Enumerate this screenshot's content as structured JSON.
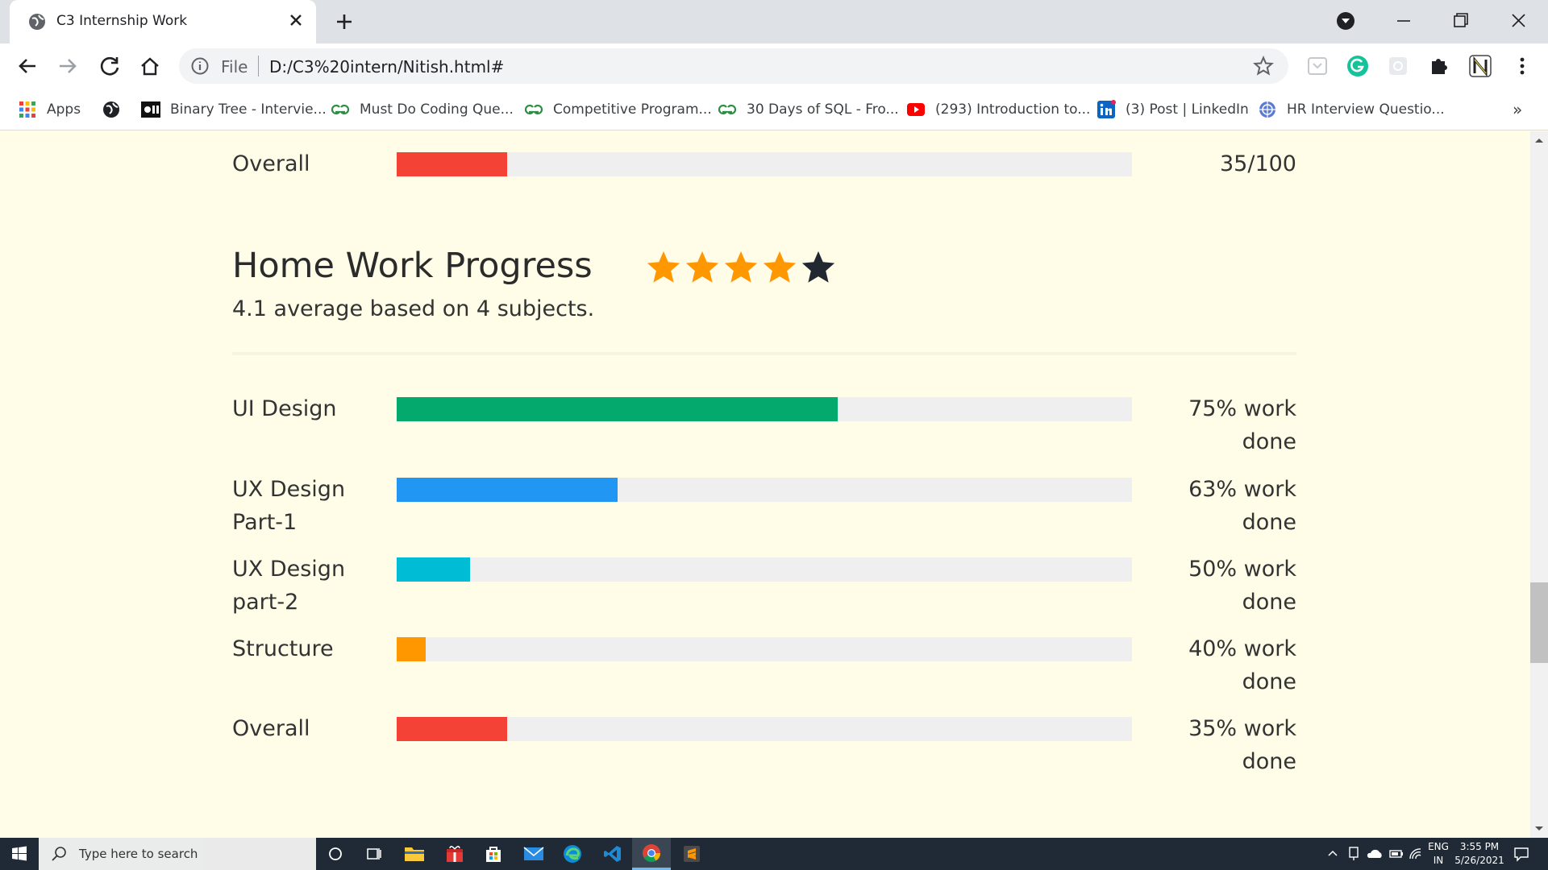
{
  "browser": {
    "tab_title": "C3 Internship Work",
    "address_scheme": "File",
    "address_url": "D:/C3%20intern/Nitish.html#",
    "bookmarks": [
      {
        "label": "Apps",
        "icon": "apps-grid-icon"
      },
      {
        "label": "",
        "icon": "globe-icon"
      },
      {
        "label": "Binary Tree - Intervie...",
        "icon": "interviewbit-icon"
      },
      {
        "label": "Must Do Coding Que...",
        "icon": "geeksforgeeks-icon"
      },
      {
        "label": "Competitive Program...",
        "icon": "geeksforgeeks-icon"
      },
      {
        "label": "30 Days of SQL - Fro...",
        "icon": "geeksforgeeks-icon"
      },
      {
        "label": "(293) Introduction to...",
        "icon": "youtube-icon"
      },
      {
        "label": "(3) Post | LinkedIn",
        "icon": "linkedin-icon"
      },
      {
        "label": "HR Interview Questio...",
        "icon": "site-icon"
      }
    ],
    "more_bookmarks": "»"
  },
  "page": {
    "top_overall": {
      "label": "Overall",
      "value": "35/100",
      "percent": 15,
      "color": "#f44336"
    },
    "homework": {
      "title": "Home Work Progress",
      "rating": 4,
      "rating_max": 5,
      "star_color": "#ff9800",
      "subtitle": "4.1 average based on 4 subjects.",
      "rows": [
        {
          "label": "UI Design",
          "value": "75% work done",
          "percent": 60,
          "color": "#04aa6d"
        },
        {
          "label": "UX Design Part-1",
          "value": "63% work done",
          "percent": 30,
          "color": "#2196f3"
        },
        {
          "label": "UX Design part-2",
          "value": "50% work done",
          "percent": 10,
          "color": "#00bcd4"
        },
        {
          "label": "Structure",
          "value": "40% work done",
          "percent": 4,
          "color": "#ff9800"
        },
        {
          "label": "Overall",
          "value": "35% work done",
          "percent": 15,
          "color": "#f44336"
        }
      ]
    }
  },
  "taskbar": {
    "search_placeholder": "Type here to search",
    "language_line1": "ENG",
    "language_line2": "IN",
    "time": "3:55 PM",
    "date": "5/26/2021"
  }
}
